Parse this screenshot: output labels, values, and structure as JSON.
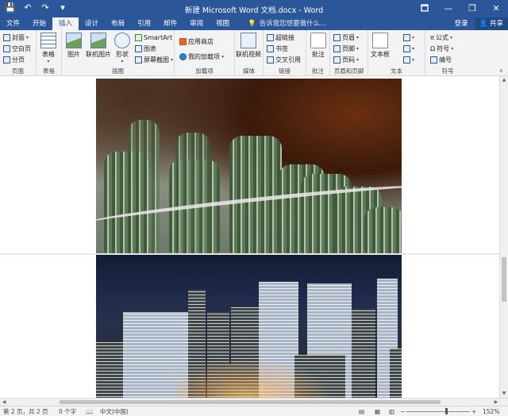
{
  "window": {
    "title": "新建 Microsoft Word 文档.docx - Word",
    "controls": [
      "🗖",
      "—",
      "❐",
      "✕"
    ]
  },
  "qat": {
    "save_icon": "💾",
    "undo_icon": "↶",
    "redo_icon": "↷",
    "customize_icon": "▾"
  },
  "tabs": [
    {
      "label": "文件"
    },
    {
      "label": "开始"
    },
    {
      "label": "插入"
    },
    {
      "label": "设计"
    },
    {
      "label": "布局"
    },
    {
      "label": "引用"
    },
    {
      "label": "邮件"
    },
    {
      "label": "审阅"
    },
    {
      "label": "视图"
    }
  ],
  "active_tab": "插入",
  "tellme": {
    "placeholder": "告诉我您想要做什么..."
  },
  "account": {
    "login": "登录",
    "share": "共享"
  },
  "ribbon": {
    "pages": {
      "cover": "封面",
      "blank": "空白页",
      "break": "分页",
      "label": "页面"
    },
    "tables": {
      "table": "表格",
      "label": "表格"
    },
    "illustrations": {
      "picture": "图片",
      "online_picture": "联机图片",
      "shapes": "形状",
      "smartart": "SmartArt",
      "chart": "图表",
      "screenshot": "屏幕截图",
      "label": "插图"
    },
    "addins": {
      "store": "应用商店",
      "my_addins": "我的加载项",
      "label": "加载项"
    },
    "media": {
      "online_video": "联机视频",
      "label": "媒体"
    },
    "links": {
      "hyperlink": "超链接",
      "bookmark": "书签",
      "cross_ref": "交叉引用",
      "label": "链接"
    },
    "comments": {
      "comment": "批注",
      "label": "批注"
    },
    "header_footer": {
      "header": "页眉",
      "footer": "页脚",
      "page_number": "页码",
      "label": "页眉和页脚"
    },
    "text": {
      "textbox": "文本框",
      "label": "文本"
    },
    "symbols": {
      "equation": "公式",
      "symbol": "符号",
      "number": "编号",
      "label": "符号"
    }
  },
  "status": {
    "page": "第 2 页，共 2 页",
    "words": "0 个字",
    "language": "中文(中国)",
    "zoom": "152%",
    "zoom_minus": "−",
    "zoom_plus": "+"
  }
}
